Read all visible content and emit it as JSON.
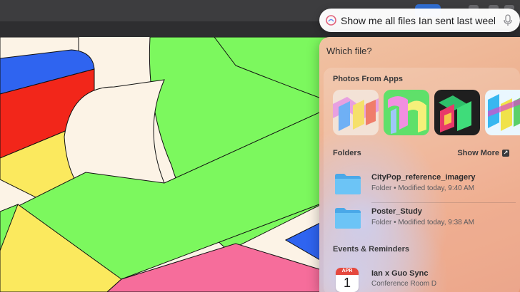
{
  "search": {
    "query": "Show me all files Ian sent last week",
    "icon": "spotlight-assistant-icon",
    "mic_icon": "microphone-icon"
  },
  "toolbar": {
    "share_color": "#2f6fd6"
  },
  "panel": {
    "title": "Which file?",
    "photos_section": {
      "title": "Photos From Apps",
      "thumbnails": [
        {
          "name": "photo-thumb-1"
        },
        {
          "name": "photo-thumb-2"
        },
        {
          "name": "photo-thumb-3"
        },
        {
          "name": "photo-thumb-4"
        }
      ]
    },
    "folders_section": {
      "title": "Folders",
      "show_more": "Show More",
      "items": [
        {
          "name": "CityPop_reference_imagery",
          "meta": "Folder • Modified today, 9:40 AM"
        },
        {
          "name": "Poster_Study",
          "meta": "Folder • Modified today, 9:38 AM"
        }
      ]
    },
    "events_section": {
      "title": "Events & Reminders",
      "items": [
        {
          "month": "APR",
          "day": "1",
          "title": "Ian x Guo Sync",
          "meta": "Conference Room D"
        }
      ]
    }
  },
  "colors": {
    "canvas_green": "#7cf85e",
    "canvas_cream": "#fcf3e6",
    "canvas_yellow": "#fbe95e",
    "canvas_blue": "#2f64f0",
    "canvas_red": "#f2261a",
    "canvas_pink": "#f66d9b",
    "folder_blue": "#5cb8f2"
  }
}
